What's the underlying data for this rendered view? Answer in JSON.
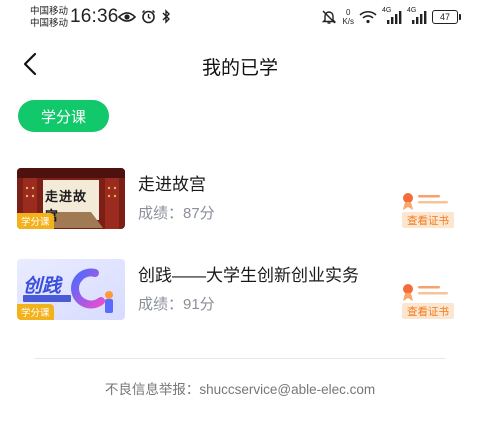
{
  "status_bar": {
    "carrier_1": "中国移动",
    "carrier_2": "中国移动",
    "time": "16:36",
    "net_speed_value": "0",
    "net_speed_unit": "K/s",
    "signal_1": "4G",
    "signal_2": "4G",
    "battery": "47"
  },
  "nav": {
    "title": "我的已学"
  },
  "tab": {
    "label": "学分课"
  },
  "courses": [
    {
      "title": "走进故宫",
      "score": "成绩：87分",
      "tag": "学分课",
      "thumb_text": "走进故宫",
      "cert_label": "查看证书"
    },
    {
      "title": "创践——大学生创新创业实务",
      "score": "成绩：91分",
      "tag": "学分课",
      "thumb_text": "创践",
      "cert_label": "查看证书"
    }
  ],
  "footer": {
    "report": "不良信息举报：shuccservice@able-elec.com"
  },
  "colors": {
    "accent": "#11c96a",
    "tag": "#f3b21b",
    "cert_text": "#f07a1e",
    "cert_bg": "#fde6cf"
  }
}
